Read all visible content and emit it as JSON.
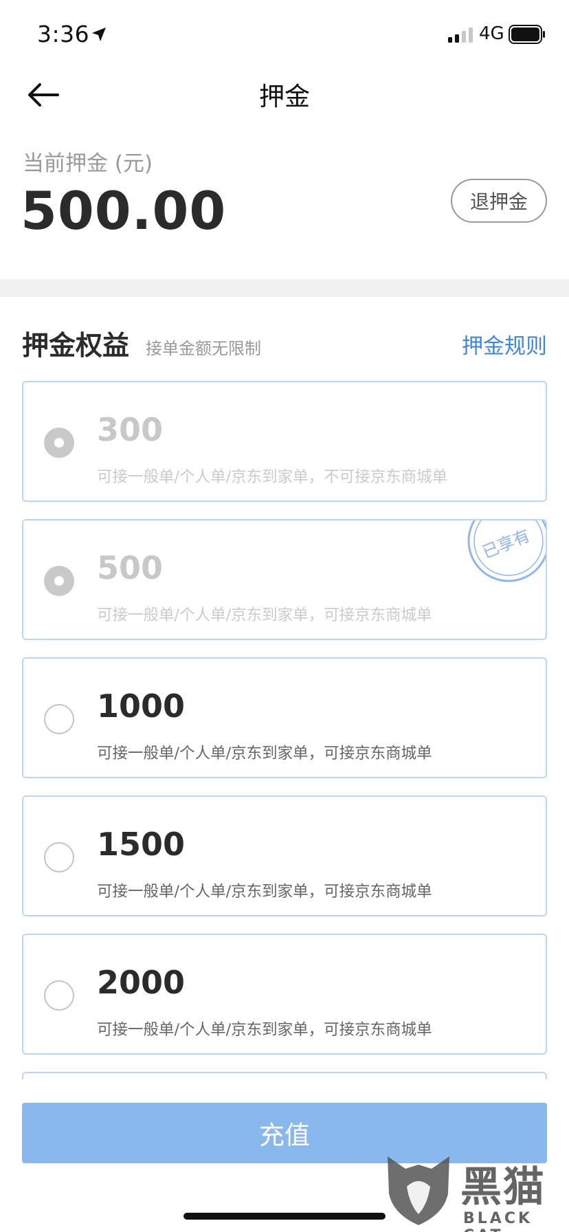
{
  "status_bar": {
    "time": "3:36",
    "network": "4G"
  },
  "nav": {
    "title": "押金"
  },
  "deposit": {
    "label": "当前押金 (元)",
    "amount": "500.00",
    "refund_label": "退押金"
  },
  "benefits": {
    "title": "押金权益",
    "subtitle": "接单金额无限制",
    "rules_link": "押金规则",
    "stamp_text": "已享有",
    "options": [
      {
        "amount": "300",
        "desc": "可接一般单/个人单/京东到家单，不可接京东商城单",
        "disabled": true
      },
      {
        "amount": "500",
        "desc": "可接一般单/个人单/京东到家单，可接京东商城单",
        "disabled": true,
        "owned": true
      },
      {
        "amount": "1000",
        "desc": "可接一般单/个人单/京东到家单，可接京东商城单",
        "disabled": false
      },
      {
        "amount": "1500",
        "desc": "可接一般单/个人单/京东到家单，可接京东商城单",
        "disabled": false
      },
      {
        "amount": "2000",
        "desc": "可接一般单/个人单/京东到家单，可接京东商城单",
        "disabled": false
      }
    ]
  },
  "recharge": {
    "label": "充值"
  },
  "watermark": {
    "cn": "黑猫",
    "en": "BLACK CAT"
  },
  "colors": {
    "accent": "#3f86e3",
    "button": "#89b8ec",
    "card_border": "#bcd6f2",
    "stamp": "#8fb6ee"
  }
}
